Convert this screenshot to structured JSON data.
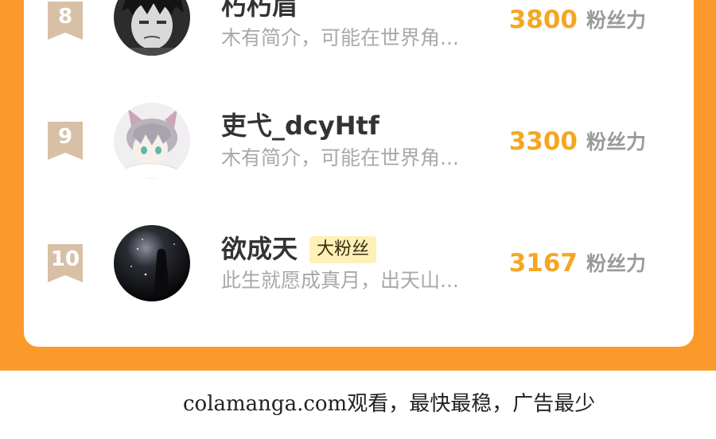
{
  "ranking": {
    "score_unit": "粉丝力",
    "entries": [
      {
        "rank": "8",
        "name": "朽朽眉",
        "bio": "木有简介，可能在世界角...",
        "score": "3800",
        "badge": ""
      },
      {
        "rank": "9",
        "name": "吏弋_dcyHtf",
        "bio": "木有简介，可能在世界角...",
        "score": "3300",
        "badge": ""
      },
      {
        "rank": "10",
        "name": "欲成天",
        "bio": "此生就愿成真月，出天山...",
        "score": "3167",
        "badge": "大粉丝"
      }
    ]
  },
  "footer": {
    "text": "colamanga.com观看，最快最稳，广告最少"
  },
  "colors": {
    "frame": "#fb9a2a",
    "score": "#f5a623",
    "rank_badge": "#d8c0a6",
    "fan_badge_bg": "#fdf1b8"
  }
}
